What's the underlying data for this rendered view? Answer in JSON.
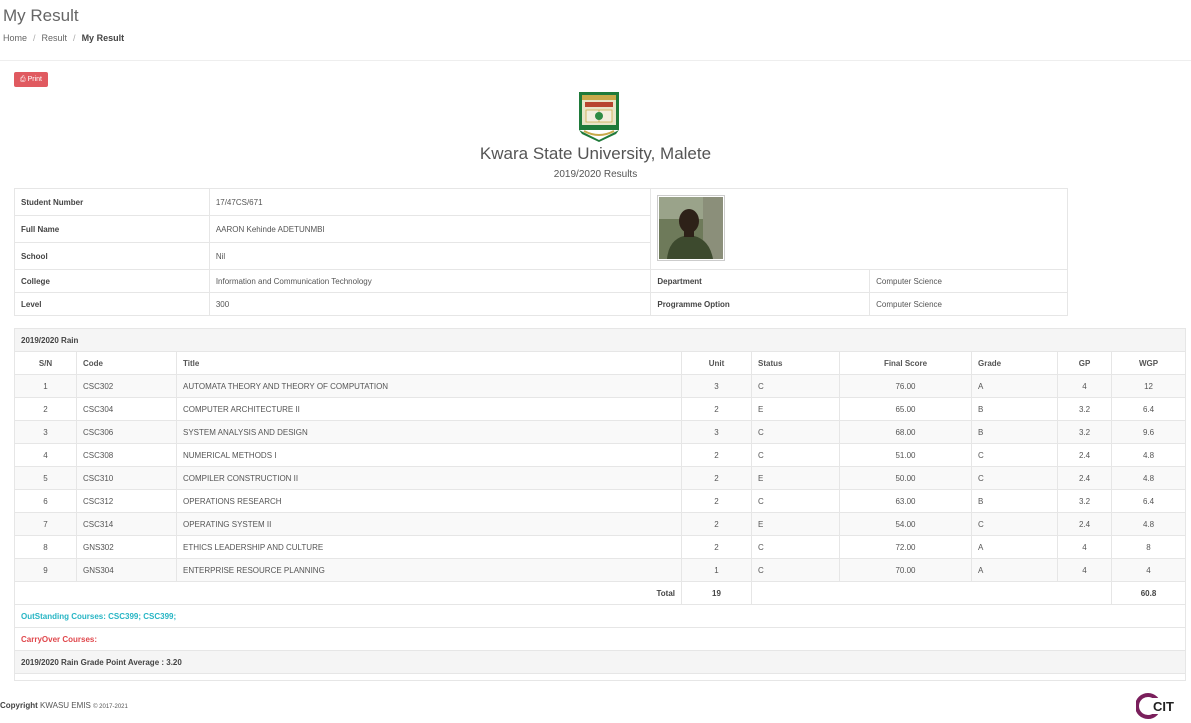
{
  "page": {
    "title": "My Result"
  },
  "breadcrumb": {
    "home": "Home",
    "result": "Result",
    "current": "My Result"
  },
  "print_label": "Print",
  "header": {
    "university": "Kwara State University, Malete",
    "session": "2019/2020 Results"
  },
  "student": {
    "number_label": "Student Number",
    "number": "17/47CS/671",
    "name_label": "Full Name",
    "name": "AARON Kehinde ADETUNMBI",
    "school_label": "School",
    "school": "Nil",
    "college_label": "College",
    "college": "Information and Communication Technology",
    "department_label": "Department",
    "department": "Computer Science",
    "level_label": "Level",
    "level": "300",
    "programme_label": "Programme Option",
    "programme": "Computer Science"
  },
  "semester": {
    "title": "2019/2020 Rain",
    "columns": [
      "S/N",
      "Code",
      "Title",
      "Unit",
      "Status",
      "Final Score",
      "Grade",
      "GP",
      "WGP"
    ],
    "rows": [
      [
        "1",
        "CSC302",
        "AUTOMATA THEORY AND THEORY OF COMPUTATION",
        "3",
        "C",
        "76.00",
        "A",
        "4",
        "12"
      ],
      [
        "2",
        "CSC304",
        "COMPUTER ARCHITECTURE II",
        "2",
        "E",
        "65.00",
        "B",
        "3.2",
        "6.4"
      ],
      [
        "3",
        "CSC306",
        "SYSTEM ANALYSIS AND DESIGN",
        "3",
        "C",
        "68.00",
        "B",
        "3.2",
        "9.6"
      ],
      [
        "4",
        "CSC308",
        "NUMERICAL METHODS I",
        "2",
        "C",
        "51.00",
        "C",
        "2.4",
        "4.8"
      ],
      [
        "5",
        "CSC310",
        "COMPILER CONSTRUCTION II",
        "2",
        "E",
        "50.00",
        "C",
        "2.4",
        "4.8"
      ],
      [
        "6",
        "CSC312",
        "OPERATIONS RESEARCH",
        "2",
        "C",
        "63.00",
        "B",
        "3.2",
        "6.4"
      ],
      [
        "7",
        "CSC314",
        "OPERATING SYSTEM II",
        "2",
        "E",
        "54.00",
        "C",
        "2.4",
        "4.8"
      ],
      [
        "8",
        "GNS302",
        "ETHICS LEADERSHIP AND CULTURE",
        "2",
        "C",
        "72.00",
        "A",
        "4",
        "8"
      ],
      [
        "9",
        "GNS304",
        "ENTERPRISE RESOURCE PLANNING",
        "1",
        "C",
        "70.00",
        "A",
        "4",
        "4"
      ]
    ],
    "total_label": "Total",
    "total_units": "19",
    "total_wgp": "60.8",
    "outstanding": "OutStanding Courses: CSC399; CSC399;",
    "carryover": "CarryOver Courses:",
    "gpa": "2019/2020 Rain Grade Point Average : 3.20"
  },
  "footer": {
    "copyright": "Copyright",
    "brand": "KWASU EMIS",
    "years": "© 2017-2021",
    "logo_text": "CIT"
  },
  "colors": {
    "print": "#e05a60",
    "outstanding": "#26b5c4",
    "carryover": "#e0474c"
  }
}
